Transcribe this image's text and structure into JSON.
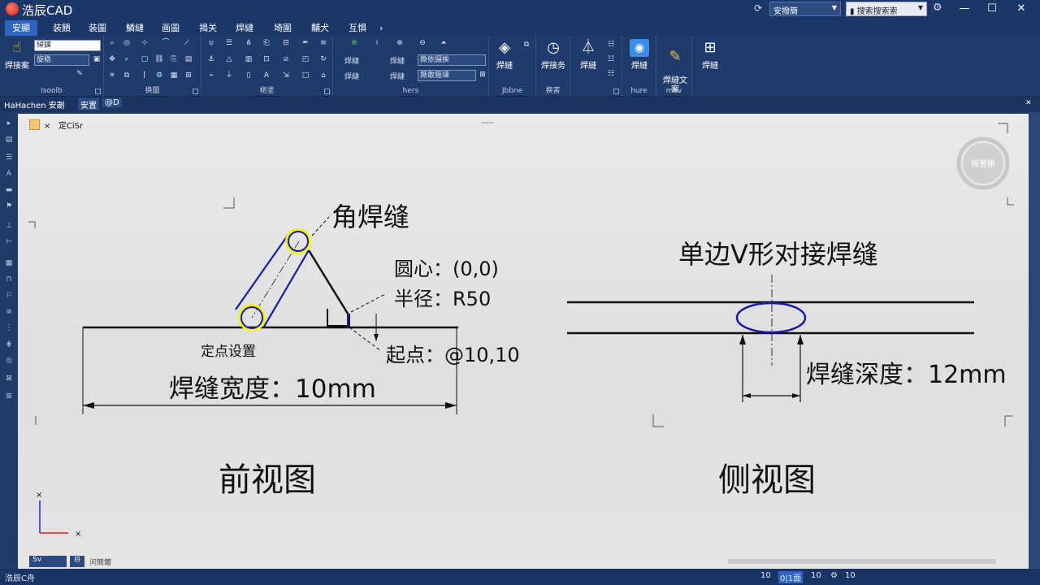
{
  "app": {
    "title": "浩辰CAD"
  },
  "titlebar": {
    "workspace": "安撥簡",
    "search_placeholder": "搜索搜索索"
  },
  "menu": {
    "items": [
      "安顯",
      "装饋",
      "装圖",
      "鱗縺",
      "画圖",
      "揭关",
      "焊縺",
      "埼圍",
      "黼犬",
      "互惧"
    ]
  },
  "ribbon": {
    "group_labels": [
      "Isoolb",
      "换圖",
      "栳塗",
      "hers",
      "Jbbne",
      "换害",
      "hure",
      "mov"
    ],
    "left_big_button": "焊接案",
    "layer_combo": "綽鍊",
    "layer_combo2": "旋稳",
    "weld_labels": [
      "焊縺",
      "焊縺",
      "焊縺",
      "焊縺",
      "撕依摄挨",
      "焊縺"
    ],
    "combo3": "撕敢箍竦",
    "big_buttons": [
      {
        "label": "焊縺",
        "icon": "cube-icon"
      },
      {
        "label": "焊接务",
        "icon": "stopwatch-icon"
      },
      {
        "label": "焊縺",
        "icon": "triangle-icon"
      },
      {
        "label": "焊縺",
        "icon": "app-tile-icon"
      },
      {
        "label": "焊縺文\n案",
        "icon": "document-icon"
      },
      {
        "label": "焊縺",
        "icon": "tool-icon"
      }
    ]
  },
  "document_tabs": {
    "items": [
      "HaHachen 安劌",
      "安置",
      "@D"
    ]
  },
  "canvas_tab": {
    "close": "×",
    "label": "定CiSr"
  },
  "viewcube": {
    "label": "楕置搬"
  },
  "front_view": {
    "title": "前视图",
    "weld_label": "角焊缝",
    "center_label": "圆心：(0,0)",
    "radius_label": "半径：R50",
    "start_label": "起点：@10,10",
    "point_label": "定点设置",
    "width_label": "焊缝宽度：10mm"
  },
  "side_view": {
    "title": "侧视图",
    "weld_label": "单边V形对接焊缝",
    "depth_label": "焊缝深度：12mm"
  },
  "ucs": {
    "x": "×",
    "y": "×"
  },
  "status_row": {
    "layout": "Sv",
    "model": "问簡鍍"
  },
  "statusbar": {
    "left": "浩辰C舟",
    "items": [
      "10",
      "0|1面",
      "10",
      "10"
    ]
  },
  "colors": {
    "weld_blue": "#1a1aa6",
    "highlight_yellow": "#f2f21a",
    "ribbon_bg": "#1f3b6b"
  }
}
